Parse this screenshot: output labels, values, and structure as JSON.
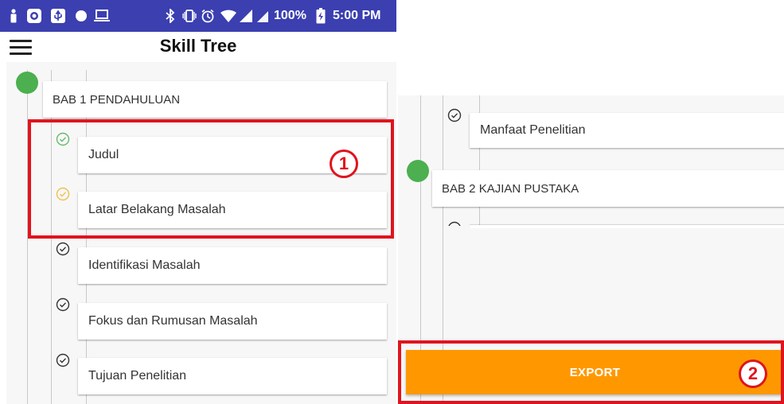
{
  "status_bar": {
    "battery": "100%",
    "time": "5:00 PM",
    "icons": [
      "person-icon",
      "screen-record-icon",
      "usb-icon",
      "circle-icon",
      "laptop-icon",
      "bluetooth-icon",
      "vibrate-icon",
      "alarm-icon",
      "wifi-icon",
      "signal-icon",
      "signal-icon",
      "battery-icon"
    ]
  },
  "app_bar": {
    "title": "Skill Tree",
    "menu_icon": "menu-icon"
  },
  "left_panel": {
    "chapter": "BAB 1 PENDAHULUAN",
    "items": [
      {
        "label": "Judul",
        "status": "done",
        "status_color": "#66bb6a"
      },
      {
        "label": "Latar Belakang Masalah",
        "status": "in-progress",
        "status_color": "#f0c14b"
      },
      {
        "label": "Identifikasi Masalah",
        "status": "locked",
        "status_color": "#333333"
      },
      {
        "label": "Fokus dan Rumusan Masalah",
        "status": "locked",
        "status_color": "#333333"
      },
      {
        "label": "Tujuan Penelitian",
        "status": "locked",
        "status_color": "#333333"
      }
    ]
  },
  "right_panel": {
    "items": [
      {
        "label": "Manfaat Penelitian",
        "status": "locked",
        "status_color": "#333333"
      }
    ],
    "chapter": "BAB 2 KAJIAN PUSTAKA",
    "export_label": "EXPORT"
  },
  "annotations": {
    "badge_1": "1",
    "badge_2": "2",
    "color": "#e0141e"
  },
  "colors": {
    "status_bar": "#3b3fb0",
    "node": "#4caf50",
    "export": "#ff9800"
  }
}
